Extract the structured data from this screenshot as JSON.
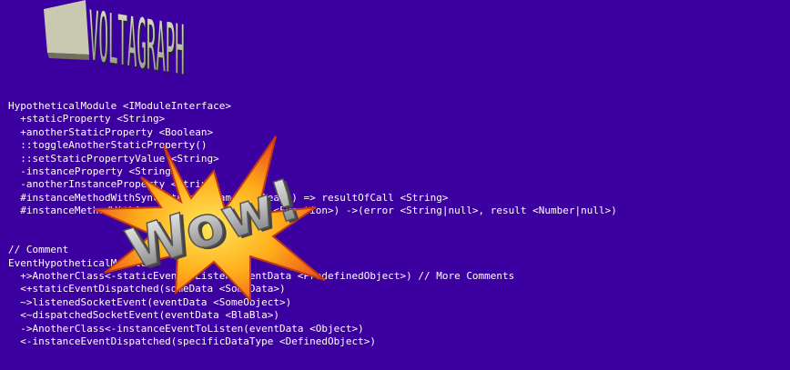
{
  "logo": {
    "text": "VOLTAGRAPH"
  },
  "badge": {
    "text": "Wow!"
  },
  "code_lines": [
    "HypotheticalModule <IModuleInterface>",
    "  +staticProperty <String>",
    "  +anotherStaticProperty <Boolean>",
    "  ::toggleAnotherStaticProperty()",
    "  ::setStaticPropertyValue <String>",
    "  -instanceProperty <String>",
    "  -anotherInstanceProperty <String>",
    "  #instanceMethodWithSyncReturn(param <Boolean>) => resultOfCall <String>",
    "  #instanceMethodWithAsyncCallback(callback <Function>) ->(error <String|null>, result <Number|null>)",
    "",
    "",
    "// Comment",
    "EventHypotheticalModule",
    "  +>AnotherClass<-staticEventToListen(eventData <PredefinedObject>) // More Comments",
    "  <+staticEventDispatched(someData <SomeData>)",
    "  ~>listenedSocketEvent(eventData <SomeObject>)",
    "  <~dispatchedSocketEvent(eventData <BlaBla>)",
    "  ->AnotherClass<-instanceEventToListen(eventData <Object>)",
    "  <-instanceEventDispatched(specificDataType <DefinedObject>)"
  ]
}
